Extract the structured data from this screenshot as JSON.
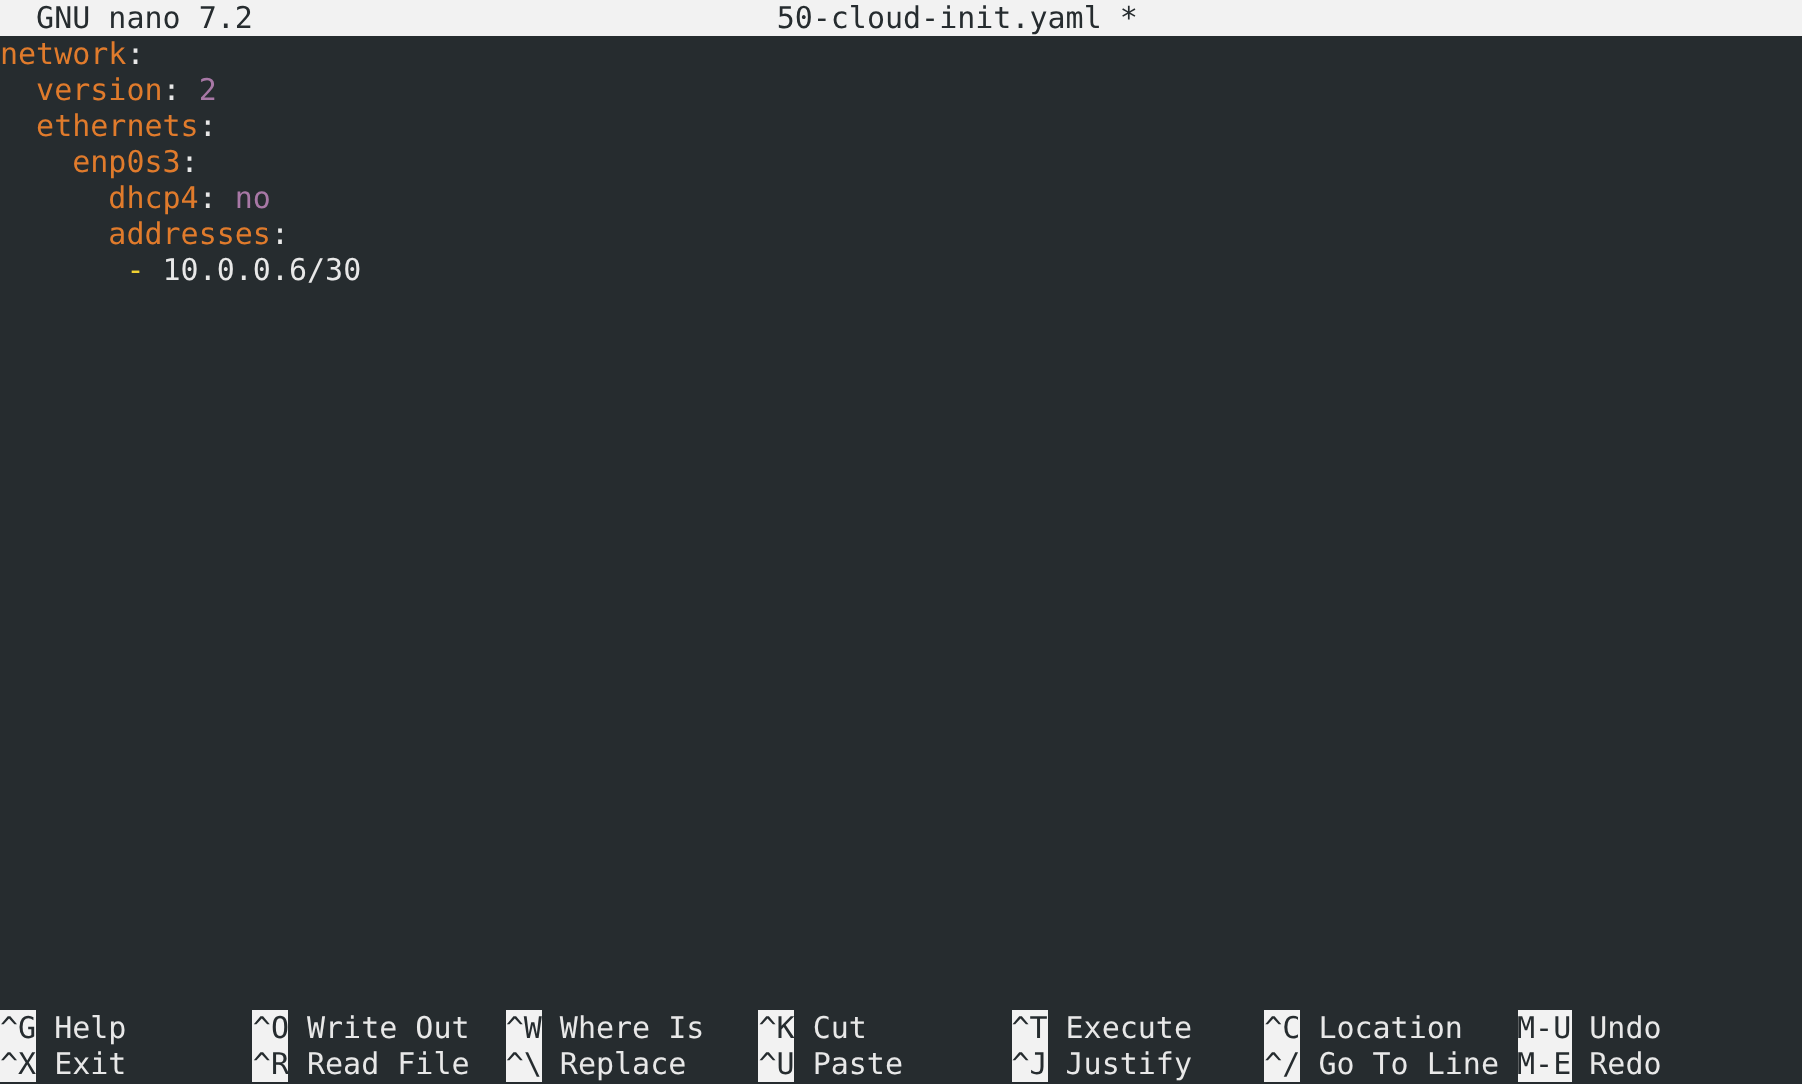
{
  "title_bar": {
    "program": "GNU nano 7.2",
    "filename": "50-cloud-init.yaml *"
  },
  "editor": {
    "lines": [
      {
        "segments": [
          {
            "kind": "key",
            "text": "network"
          },
          {
            "kind": "punct",
            "text": ":"
          }
        ],
        "children": [
          {
            "segments": [
              {
                "kind": "key",
                "text": "version"
              },
              {
                "kind": "punct",
                "text": ": "
              },
              {
                "kind": "scalar",
                "text": "2"
              }
            ]
          },
          {
            "segments": [
              {
                "kind": "key",
                "text": "ethernets"
              },
              {
                "kind": "punct",
                "text": ":"
              }
            ],
            "children": [
              {
                "segments": [
                  {
                    "kind": "key",
                    "text": "enp0s3"
                  },
                  {
                    "kind": "punct",
                    "text": ":"
                  }
                ],
                "children": [
                  {
                    "segments": [
                      {
                        "kind": "key",
                        "text": "dhcp4"
                      },
                      {
                        "kind": "punct",
                        "text": ": "
                      },
                      {
                        "kind": "scalar",
                        "text": "no"
                      }
                    ]
                  },
                  {
                    "segments": [
                      {
                        "kind": "key",
                        "text": "addresses"
                      },
                      {
                        "kind": "punct",
                        "text": ":"
                      }
                    ],
                    "children": [
                      {
                        "segments": [
                          {
                            "kind": "dash",
                            "text": "- "
                          },
                          {
                            "kind": "plain",
                            "text": "10.0.0.6/30"
                          }
                        ]
                      }
                    ]
                  }
                ]
              }
            ]
          }
        ]
      }
    ]
  },
  "shortcuts": [
    [
      {
        "key": "^G",
        "label": "Help"
      },
      {
        "key": "^O",
        "label": "Write Out"
      },
      {
        "key": "^W",
        "label": "Where Is"
      },
      {
        "key": "^K",
        "label": "Cut"
      },
      {
        "key": "^T",
        "label": "Execute"
      },
      {
        "key": "^C",
        "label": "Location"
      },
      {
        "key": "M-U",
        "label": "Undo"
      }
    ],
    [
      {
        "key": "^X",
        "label": "Exit"
      },
      {
        "key": "^R",
        "label": "Read File"
      },
      {
        "key": "^\\",
        "label": "Replace"
      },
      {
        "key": "^U",
        "label": "Paste"
      },
      {
        "key": "^J",
        "label": "Justify"
      },
      {
        "key": "^/",
        "label": "Go To Line"
      },
      {
        "key": "M-E",
        "label": "Redo"
      }
    ]
  ]
}
